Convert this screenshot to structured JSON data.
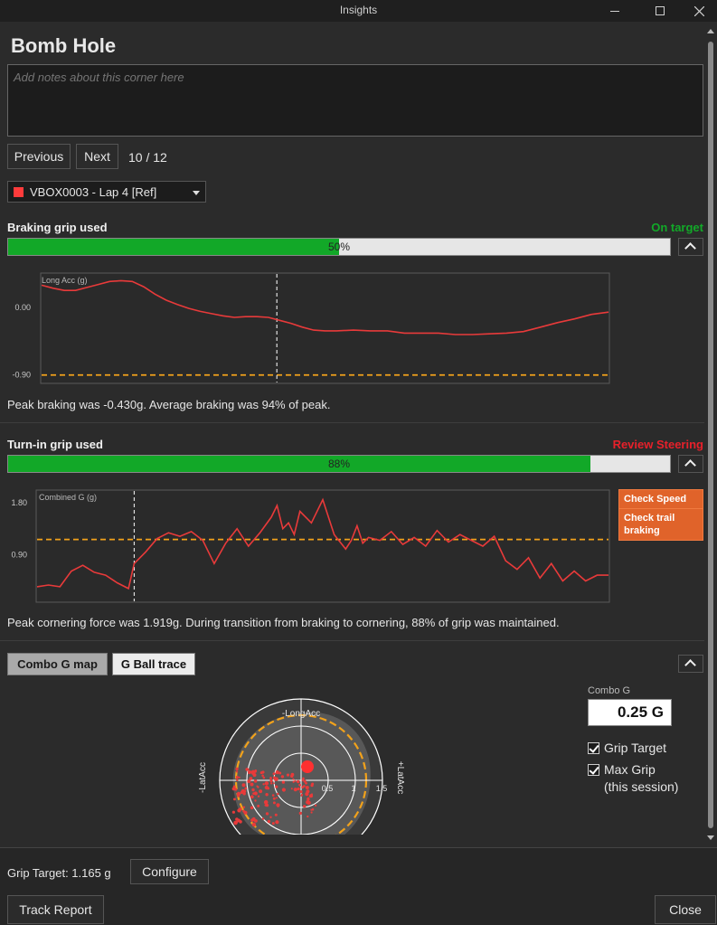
{
  "window": {
    "title": "Insights"
  },
  "corner": {
    "name": "Bomb Hole",
    "notes_placeholder": "Add notes about this corner here"
  },
  "nav": {
    "previous": "Previous",
    "next": "Next",
    "counter": "10 / 12"
  },
  "lap": {
    "selected": "VBOX0003 - Lap 4 [Ref]",
    "color": "#ff3b3b"
  },
  "braking": {
    "title": "Braking grip used",
    "status": "On target",
    "status_color": "#12a828",
    "grip_used_pct": 50,
    "grip_label": "50%",
    "description": "Peak braking was -0.430g. Average braking was 94% of peak.",
    "chart_data": {
      "type": "line",
      "ylabel": "Long Acc (g)",
      "yticks": [
        "0.00",
        "-0.90"
      ],
      "ylim": [
        -1.0,
        0.45
      ],
      "target": -0.9,
      "marker_x": 0.415,
      "series": [
        {
          "color": "#e83a3a",
          "x": [
            0,
            0.02,
            0.04,
            0.06,
            0.08,
            0.1,
            0.12,
            0.14,
            0.16,
            0.18,
            0.2,
            0.22,
            0.24,
            0.26,
            0.28,
            0.3,
            0.32,
            0.34,
            0.36,
            0.38,
            0.4,
            0.42,
            0.44,
            0.46,
            0.48,
            0.5,
            0.52,
            0.55,
            0.58,
            0.61,
            0.64,
            0.67,
            0.7,
            0.73,
            0.76,
            0.79,
            0.82,
            0.85,
            0.88,
            0.91,
            0.94,
            0.97,
            1.0
          ],
          "y": [
            0.3,
            0.26,
            0.23,
            0.23,
            0.27,
            0.31,
            0.35,
            0.36,
            0.35,
            0.28,
            0.18,
            0.1,
            0.04,
            -0.01,
            -0.05,
            -0.08,
            -0.11,
            -0.13,
            -0.12,
            -0.12,
            -0.13,
            -0.17,
            -0.21,
            -0.26,
            -0.3,
            -0.31,
            -0.31,
            -0.3,
            -0.31,
            -0.31,
            -0.34,
            -0.34,
            -0.34,
            -0.36,
            -0.36,
            -0.35,
            -0.34,
            -0.32,
            -0.26,
            -0.2,
            -0.15,
            -0.09,
            -0.06
          ]
        }
      ]
    }
  },
  "turnin": {
    "title": "Turn-in grip used",
    "status": "Review Steering",
    "status_color": "#e8202a",
    "grip_used_pct": 88,
    "grip_label": "88%",
    "actions": [
      "Check Speed",
      "Check trail braking"
    ],
    "description": "Peak cornering force was 1.919g. During transition from braking to cornering, 88% of grip was maintained.",
    "chart_data": {
      "type": "line",
      "ylabel": "Combined G (g)",
      "yticks": [
        "1.80",
        "0.90"
      ],
      "ylim": [
        0.1,
        2.0
      ],
      "target": 1.165,
      "marker_x": 0.17,
      "series": [
        {
          "color": "#e83a3a",
          "x": [
            0,
            0.02,
            0.04,
            0.06,
            0.08,
            0.1,
            0.12,
            0.14,
            0.16,
            0.17,
            0.19,
            0.21,
            0.23,
            0.25,
            0.27,
            0.29,
            0.31,
            0.33,
            0.35,
            0.37,
            0.39,
            0.41,
            0.42,
            0.43,
            0.44,
            0.45,
            0.46,
            0.48,
            0.5,
            0.52,
            0.54,
            0.55,
            0.56,
            0.57,
            0.58,
            0.6,
            0.62,
            0.64,
            0.66,
            0.68,
            0.7,
            0.72,
            0.74,
            0.76,
            0.78,
            0.8,
            0.82,
            0.84,
            0.86,
            0.88,
            0.9,
            0.92,
            0.94,
            0.96,
            0.98,
            1.0
          ],
          "y": [
            0.35,
            0.38,
            0.35,
            0.62,
            0.72,
            0.6,
            0.55,
            0.42,
            0.32,
            0.75,
            0.95,
            1.18,
            1.28,
            1.22,
            1.3,
            1.15,
            0.75,
            1.1,
            1.35,
            1.05,
            1.28,
            1.55,
            1.75,
            1.35,
            1.45,
            1.25,
            1.65,
            1.45,
            1.85,
            1.25,
            1.0,
            1.15,
            1.4,
            1.1,
            1.2,
            1.15,
            1.3,
            1.08,
            1.2,
            1.05,
            1.32,
            1.12,
            1.25,
            1.15,
            1.05,
            1.22,
            0.8,
            0.65,
            0.85,
            0.5,
            0.75,
            0.45,
            0.62,
            0.45,
            0.55,
            0.55
          ]
        }
      ]
    }
  },
  "gmap": {
    "tabs": [
      "Combo G map",
      "G Ball trace"
    ],
    "axis_top": "-LongAcc",
    "axis_left": "-LatAcc",
    "axis_right": "+LatAcc",
    "ring_labels": [
      "0.5",
      "1",
      "1.5"
    ],
    "combo_g_label": "Combo G",
    "combo_g_value": "0.25 G",
    "grip_target_label": "Grip Target",
    "max_grip_label": "Max Grip",
    "max_grip_sub": "(this session)",
    "grip_target_color": "#f2a21b"
  },
  "footer": {
    "grip_target_text": "Grip Target: 1.165 g",
    "configure": "Configure",
    "track_report": "Track Report",
    "close": "Close"
  }
}
